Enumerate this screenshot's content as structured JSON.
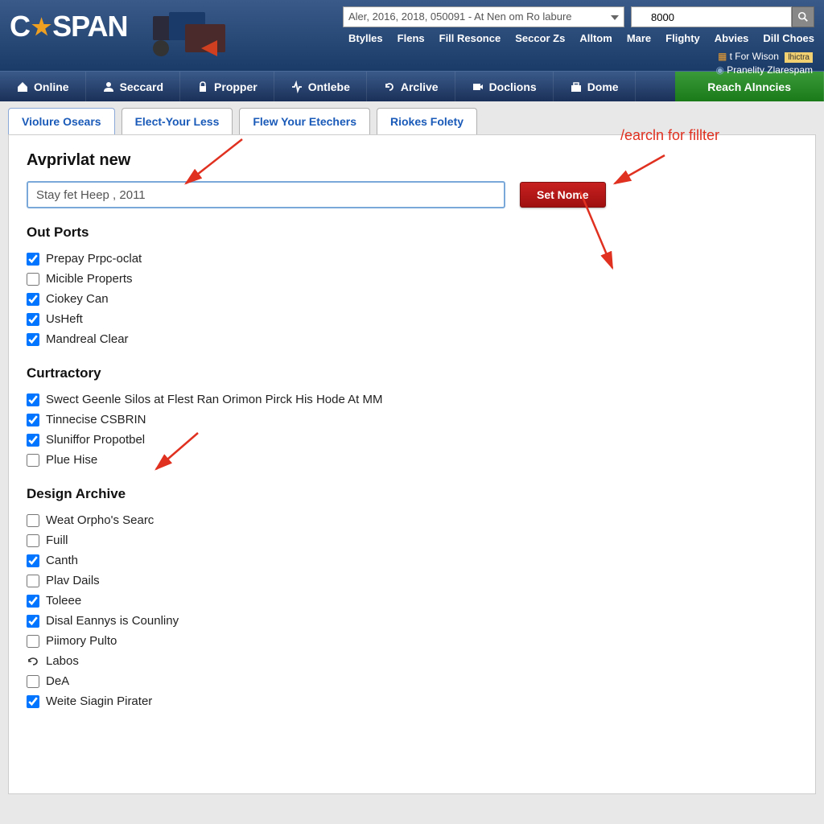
{
  "header": {
    "logo_prefix": "C",
    "logo_suffix": "SPAN",
    "dropdown_value": "Aler, 2016, 2018, 050091 - At Nen om Ro labure",
    "search_value": "8000",
    "links": [
      "Btylles",
      "Flens",
      "Fill Resonce",
      "Seccor Zs",
      "Alltom",
      "Mare",
      "Flighty",
      "Abvies",
      "Dill Choes"
    ],
    "sub1": "t For Wison",
    "sub1_badge": "lhictra",
    "sub2": "Pranelity Zlarespam"
  },
  "nav": [
    {
      "label": "Online",
      "icon": "home"
    },
    {
      "label": "Seccard",
      "icon": "user"
    },
    {
      "label": "Propper",
      "icon": "lock"
    },
    {
      "label": "Ontlebe",
      "icon": "activity"
    },
    {
      "label": "Arclive",
      "icon": "refresh"
    },
    {
      "label": "Doclions",
      "icon": "video"
    },
    {
      "label": "Dome",
      "icon": "briefcase"
    }
  ],
  "nav_green": "Reach Alnncies",
  "tabs": [
    "Violure Osears",
    "Elect-Your Less",
    "Flew Your Etechers",
    "Riokes Folety"
  ],
  "main": {
    "heading": "Avprivlat new",
    "input_value": "Stay fet Heep , 2011",
    "button_label": "Set Nome",
    "annotation_text": "/earcln for fillter",
    "sections": [
      {
        "title": "Out Ports",
        "items": [
          {
            "label": "Prepay Prpc-oclat",
            "checked": true
          },
          {
            "label": "Micible Properts",
            "checked": false
          },
          {
            "label": "Ciokey Can",
            "checked": true
          },
          {
            "label": "UsHeft",
            "checked": true
          },
          {
            "label": "Mandreal Clear",
            "checked": true
          }
        ]
      },
      {
        "title": "Curtractory",
        "items": [
          {
            "label": "Swect Geenle Silos at Flest Ran Orimon Pirck His Hode At MM",
            "checked": true
          },
          {
            "label": "Tinnecise CSBRIN",
            "checked": true
          },
          {
            "label": "Sluniffor Propotbel",
            "checked": true
          },
          {
            "label": "Plue Hise",
            "checked": false
          }
        ]
      },
      {
        "title": "Design Archive",
        "items": [
          {
            "label": "Weat Orpho's Searc",
            "checked": false
          },
          {
            "label": "Fuill",
            "checked": false
          },
          {
            "label": "Canth",
            "checked": true
          },
          {
            "label": "Plav Dails",
            "checked": false
          },
          {
            "label": "Toleee",
            "checked": true
          },
          {
            "label": "Disal Eannys is Counliny",
            "checked": true
          },
          {
            "label": "Piimory Pulto",
            "checked": false
          },
          {
            "label": "Labos",
            "checked": false,
            "icon": "loop"
          },
          {
            "label": "DeA",
            "checked": false
          },
          {
            "label": "Weite Siagin Pirater",
            "checked": true
          }
        ]
      }
    ]
  }
}
